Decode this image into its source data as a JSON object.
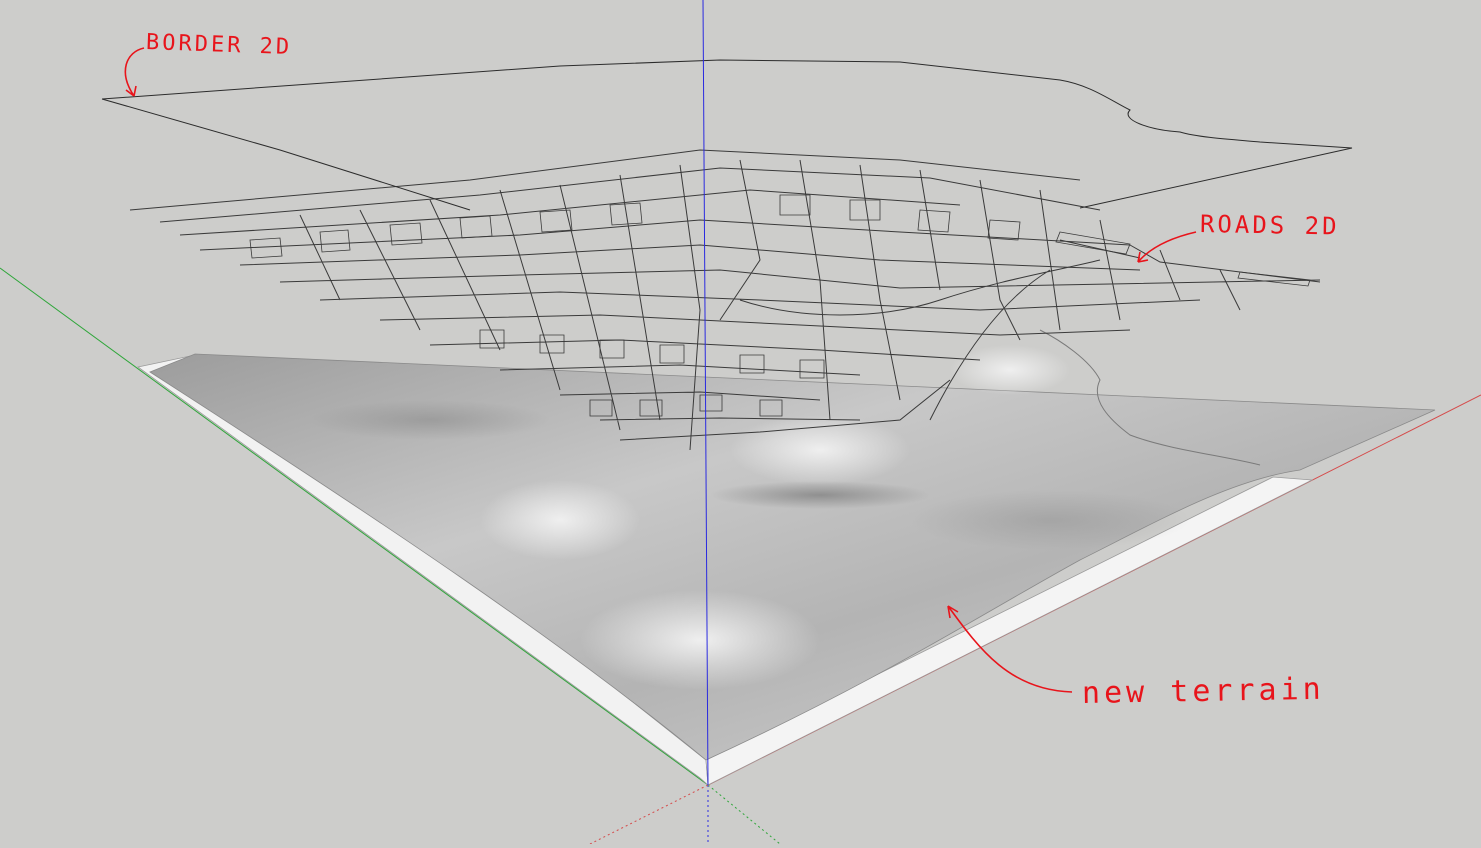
{
  "viewport": {
    "background": "#cdcdcb",
    "axis_colors": {
      "red": "#d54a4a",
      "green": "#2fa63a",
      "blue": "#2a2ae0"
    }
  },
  "annotations": {
    "border_label": "BORDER 2D",
    "roads_label": "ROADS 2D",
    "terrain_label": "new terrain",
    "color": "#e8141b"
  }
}
